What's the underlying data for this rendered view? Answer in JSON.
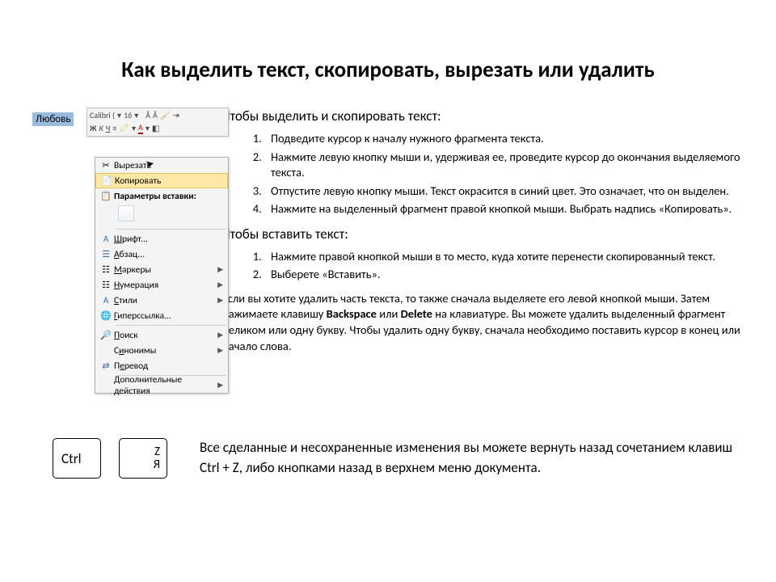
{
  "title": "Как выделить текст, скопировать, вырезать или удалить",
  "selected_word": "Любовь",
  "mini_toolbar": {
    "font": "Calibri (",
    "size": "16",
    "bold": "Ж",
    "italic": "К",
    "underline": "Ч"
  },
  "menu": {
    "cut": "Вырезать",
    "copy": "Копировать",
    "paste_params": "Параметры вставки:",
    "font": "Шрифт...",
    "paragraph": "Абзац...",
    "bullets": "Маркеры",
    "numbering": "Нумерация",
    "styles": "Стили",
    "hyperlink": "Гиперссылка...",
    "search": "Поиск",
    "synonyms": "Синонимы",
    "translate": "Перевод",
    "additional": "Дополнительные действия"
  },
  "sec1_head": "Чтобы выделить и скопировать текст:",
  "sec1": {
    "i1": "Подведите курсор к началу нужного фрагмента текста.",
    "i2": "Нажмите левую кнопку мыши и, удерживая ее, проведите курсор до окончания выделяемого текста.",
    "i3": "Отпустите левую кнопку мыши. Текст окрасится в синий цвет. Это означает, что он выделен.",
    "i4": "Нажмите на выделенный фрагмент правой кнопкой мыши. Выбрать надпись «Копировать»."
  },
  "sec2_head": "Чтобы вставить текст:",
  "sec2": {
    "i1": "Нажмите правой кнопкой мыши в то место, куда хотите перенести скопированный текст.",
    "i2": "Выберете «Вставить»."
  },
  "delete_text_pre": "Если вы хотите удалить часть текста, то также сначала выделяете его левой кнопкой мыши. Затем нажимаете клавишу ",
  "backspace": "Backspace",
  "or": " или ",
  "delete": "Delete",
  "delete_text_post": " на клавиатуре. Вы можете удалить выделенный фрагмент целиком или одну букву. Чтобы удалить одну букву, сначала необходимо поставить курсор в конец или начало слова.",
  "keys": {
    "ctrl": "Ctrl",
    "z_top": "Z",
    "z_bot": "Я"
  },
  "undo_text": "Все сделанные и несохраненные изменения вы можете вернуть назад сочетанием клавиш Ctrl + Z, либо кнопками назад в верхнем меню документа."
}
